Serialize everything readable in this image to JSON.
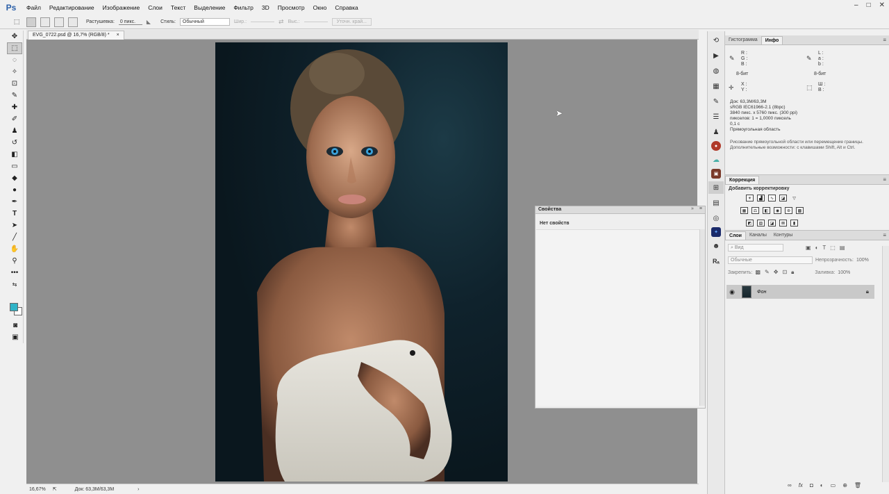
{
  "app": {
    "logo": "Ps",
    "menu": [
      "Файл",
      "Редактирование",
      "Изображение",
      "Слои",
      "Текст",
      "Выделение",
      "Фильтр",
      "3D",
      "Просмотр",
      "Окно",
      "Справка"
    ],
    "window_controls": [
      "–",
      "□",
      "✕"
    ]
  },
  "options": {
    "feather_label": "Растушевка:",
    "feather_value": "0 пикс.",
    "style_label": "Стиль:",
    "style_value": "Обычный",
    "width_label": "Шир.:",
    "height_label": "Выс.:",
    "refine_button": "Уточн. край..."
  },
  "document": {
    "tab_title": "EVG_0722.psd @ 16,7% (RGB/8) *",
    "tab_close": "×"
  },
  "status": {
    "zoom": "16,67%",
    "doc_size": "Док: 63,3M/63,3M"
  },
  "properties_panel": {
    "title": "Свойства",
    "empty_text": "Нет свойств",
    "collapse": "»",
    "menu": "≡"
  },
  "info_panel": {
    "tabs": [
      "Гистограмма",
      "Инфо"
    ],
    "active_tab": "Инфо",
    "rgb_labels": [
      "R :",
      "G :",
      "B :"
    ],
    "lab_labels": [
      "L :",
      "a :",
      "b :"
    ],
    "bit_left": "8-бит",
    "bit_right": "8-бит",
    "xy_labels": [
      "X :",
      "Y :"
    ],
    "wh_labels": [
      "Ш :",
      "В :"
    ],
    "doc_lines": [
      "Док: 63,3M/63,3M",
      "sRGB IEC61966-2.1 (8bpc)",
      "3840 пикс. x 5760 пикс. (300 ppi)",
      "пикселов: 1 = 1,0000 пиксель",
      "0,1 с",
      "Прямоугольная область"
    ],
    "hint_lines": [
      "Рисование прямоугольной области или перемещение границы.",
      "Дополнительные возможности: с клавишами Shift, Alt и Ctrl."
    ]
  },
  "correction_panel": {
    "title": "Коррекция",
    "add_label": "Добавить корректировку"
  },
  "layers_panel": {
    "tabs": [
      "Слои",
      "Каналы",
      "Контуры"
    ],
    "active_tab": "Слои",
    "kind_placeholder": "Вид",
    "blend_mode": "Обычные",
    "opacity_label": "Непрозрачность:",
    "opacity_value": "100%",
    "lock_label": "Закрепить:",
    "fill_label": "Заливка:",
    "fill_value": "100%",
    "layers": [
      {
        "name": "Фон",
        "visible": true,
        "locked": true
      }
    ]
  },
  "colors": {
    "foreground": "#2fb3c7",
    "background": "#ffffff",
    "canvas_bg": "#8f8f8f"
  }
}
